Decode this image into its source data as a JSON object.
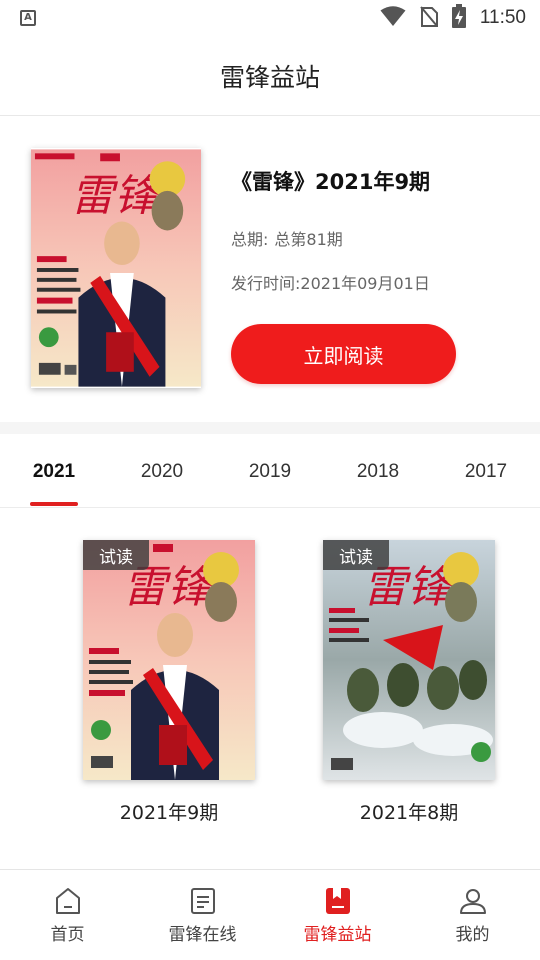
{
  "status_bar": {
    "time": "11:50"
  },
  "header": {
    "title": "雷锋益站"
  },
  "featured": {
    "title": "《雷锋》2021年9期",
    "total_label": "总期:",
    "total_value": "总第81期",
    "date_label": "发行时间:",
    "date_value": "2021年09月01日",
    "read_button": "立即阅读"
  },
  "year_tabs": [
    "2021",
    "2020",
    "2019",
    "2018",
    "2017"
  ],
  "active_year": "2021",
  "magazines": [
    {
      "badge": "试读",
      "label": "2021年9期"
    },
    {
      "badge": "试读",
      "label": "2021年8期"
    }
  ],
  "bottom_nav": [
    {
      "label": "首页",
      "icon": "home-icon"
    },
    {
      "label": "雷锋在线",
      "icon": "document-icon"
    },
    {
      "label": "雷锋益站",
      "icon": "bookmark-icon"
    },
    {
      "label": "我的",
      "icon": "user-icon"
    }
  ],
  "colors": {
    "accent": "#e02020",
    "button": "#ef1c1c"
  }
}
